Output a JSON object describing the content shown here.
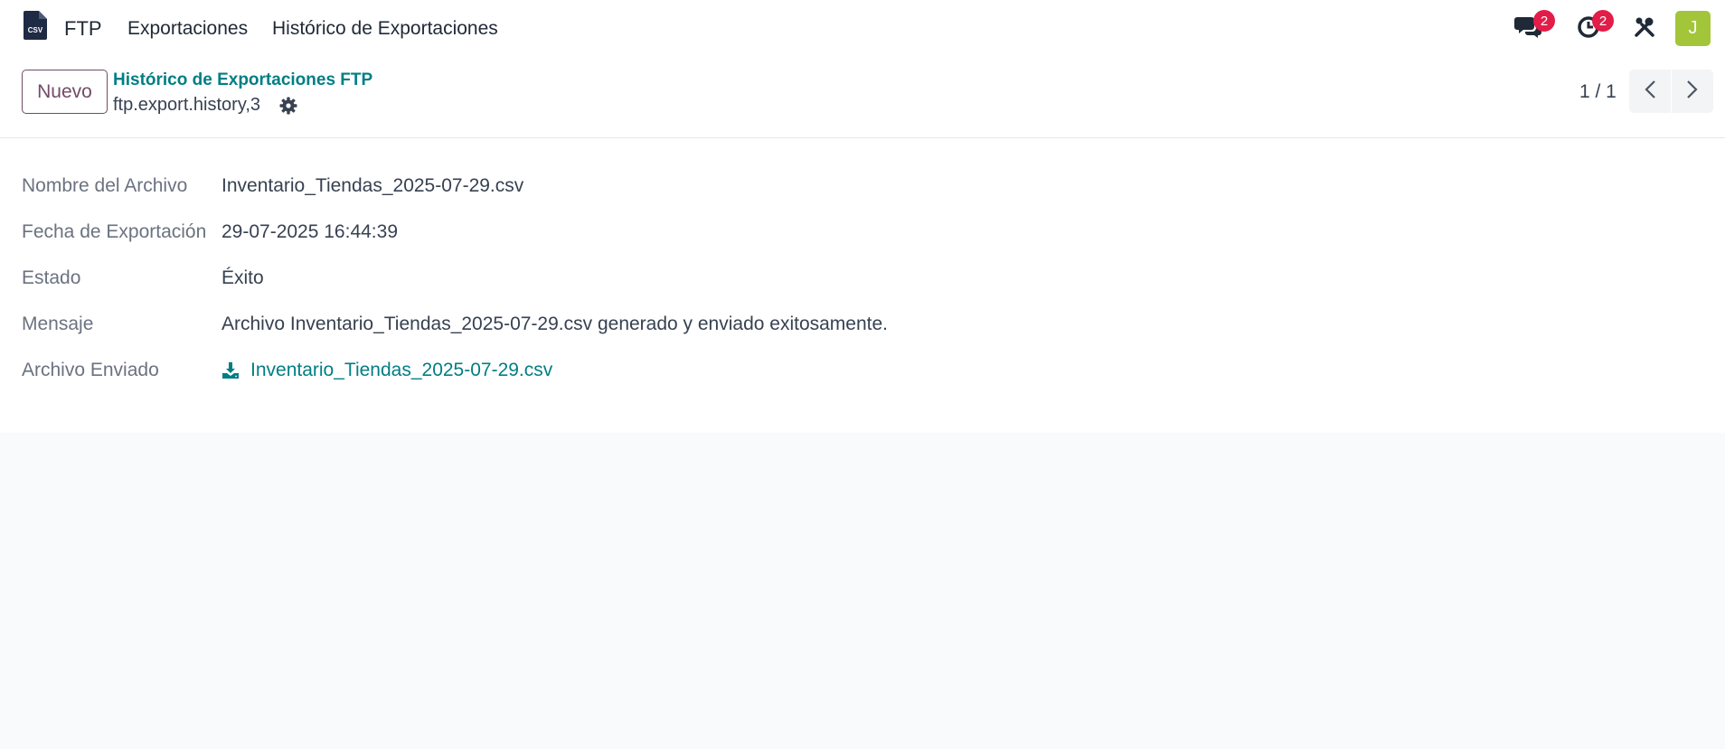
{
  "navbar": {
    "app_icon": "csv-file-icon",
    "app_name": "FTP",
    "menu": [
      "Exportaciones",
      "Histórico de Exportaciones"
    ],
    "messages_badge": "2",
    "activities_badge": "2",
    "avatar_initial": "J",
    "avatar_color": "#a3c53a"
  },
  "control_panel": {
    "new_label": "Nuevo",
    "breadcrumb": "Histórico de Exportaciones FTP",
    "record_name": "ftp.export.history,3",
    "pager": "1 / 1"
  },
  "form": {
    "fields": [
      {
        "label": "Nombre del Archivo",
        "value": "Inventario_Tiendas_2025-07-29.csv"
      },
      {
        "label": "Fecha de Exportación",
        "value": "29-07-2025 16:44:39"
      },
      {
        "label": "Estado",
        "value": "Éxito"
      },
      {
        "label": "Mensaje",
        "value": "Archivo Inventario_Tiendas_2025-07-29.csv generado y enviado exitosamente."
      },
      {
        "label": "Archivo Enviado",
        "value": "Inventario_Tiendas_2025-07-29.csv",
        "icon": "download-icon"
      }
    ]
  },
  "colors": {
    "brand": "#714b67",
    "link": "#017e84",
    "badge": "#e11d48"
  }
}
